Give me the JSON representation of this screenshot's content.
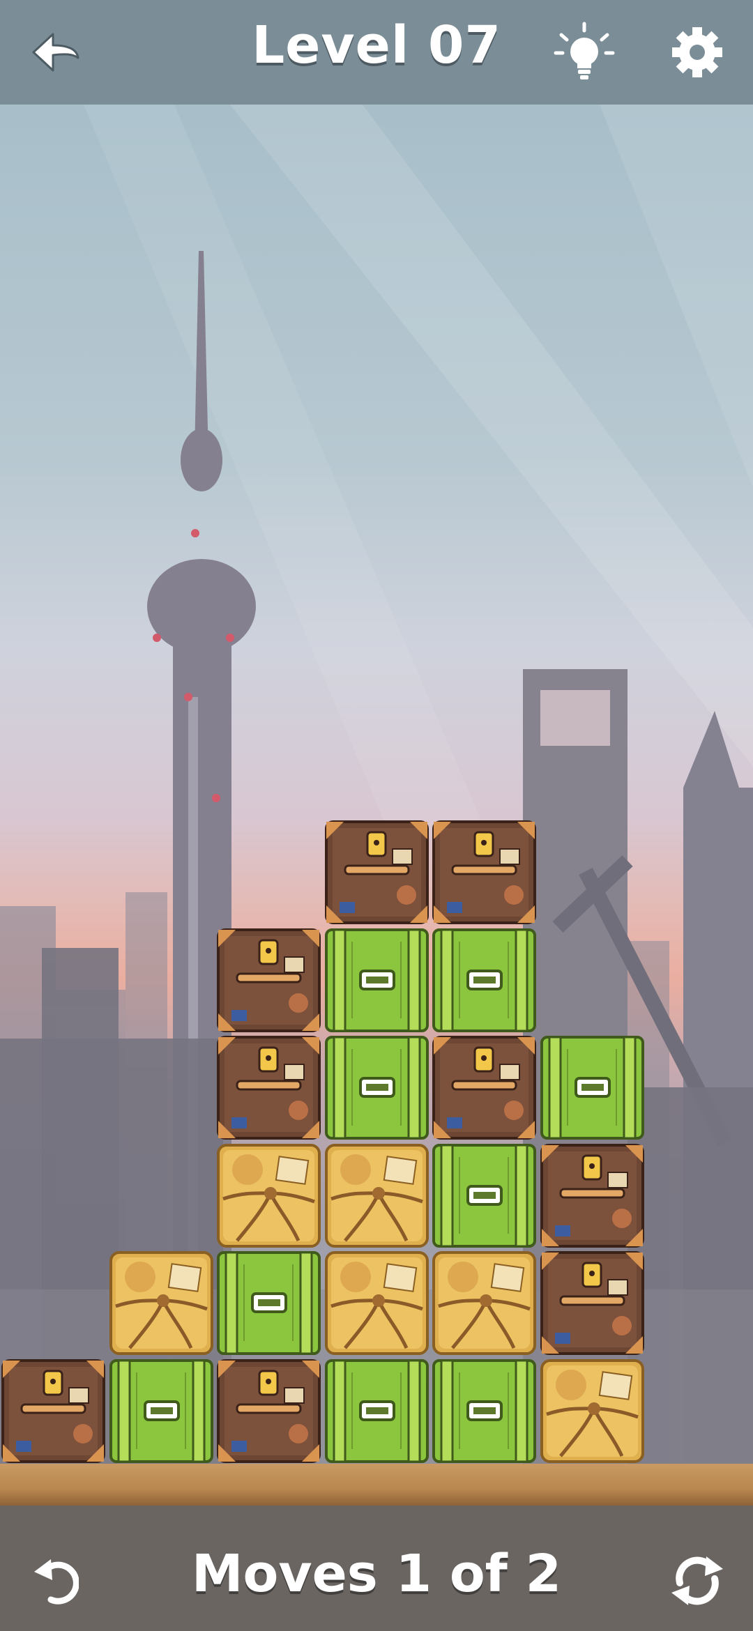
{
  "header": {
    "title": "Level 07",
    "back_icon": "back-arrow-icon",
    "hint_icon": "lightbulb-icon",
    "settings_icon": "gear-icon"
  },
  "footer": {
    "moves_text": "Moves 1 of 2",
    "undo_icon": "undo-icon",
    "restart_icon": "restart-icon"
  },
  "board": {
    "columns": 6,
    "rows": 6,
    "legend": {
      "B": "brown suitcase",
      "G": "green crate",
      "Y": "yellow parcel",
      ".": "empty"
    },
    "grid": [
      ". . . B B .",
      ". . B G G .",
      ". . B G B G",
      ". . Y Y G B",
      ". Y G Y Y B",
      "B G B G G Y"
    ]
  },
  "colors": {
    "header_bar": "#7b8d96",
    "footer_bar": "#6a6560",
    "suitcase": "#6e4634",
    "crate": "#8cc63f",
    "parcel": "#e0b04e",
    "ground": "#c99a63"
  }
}
